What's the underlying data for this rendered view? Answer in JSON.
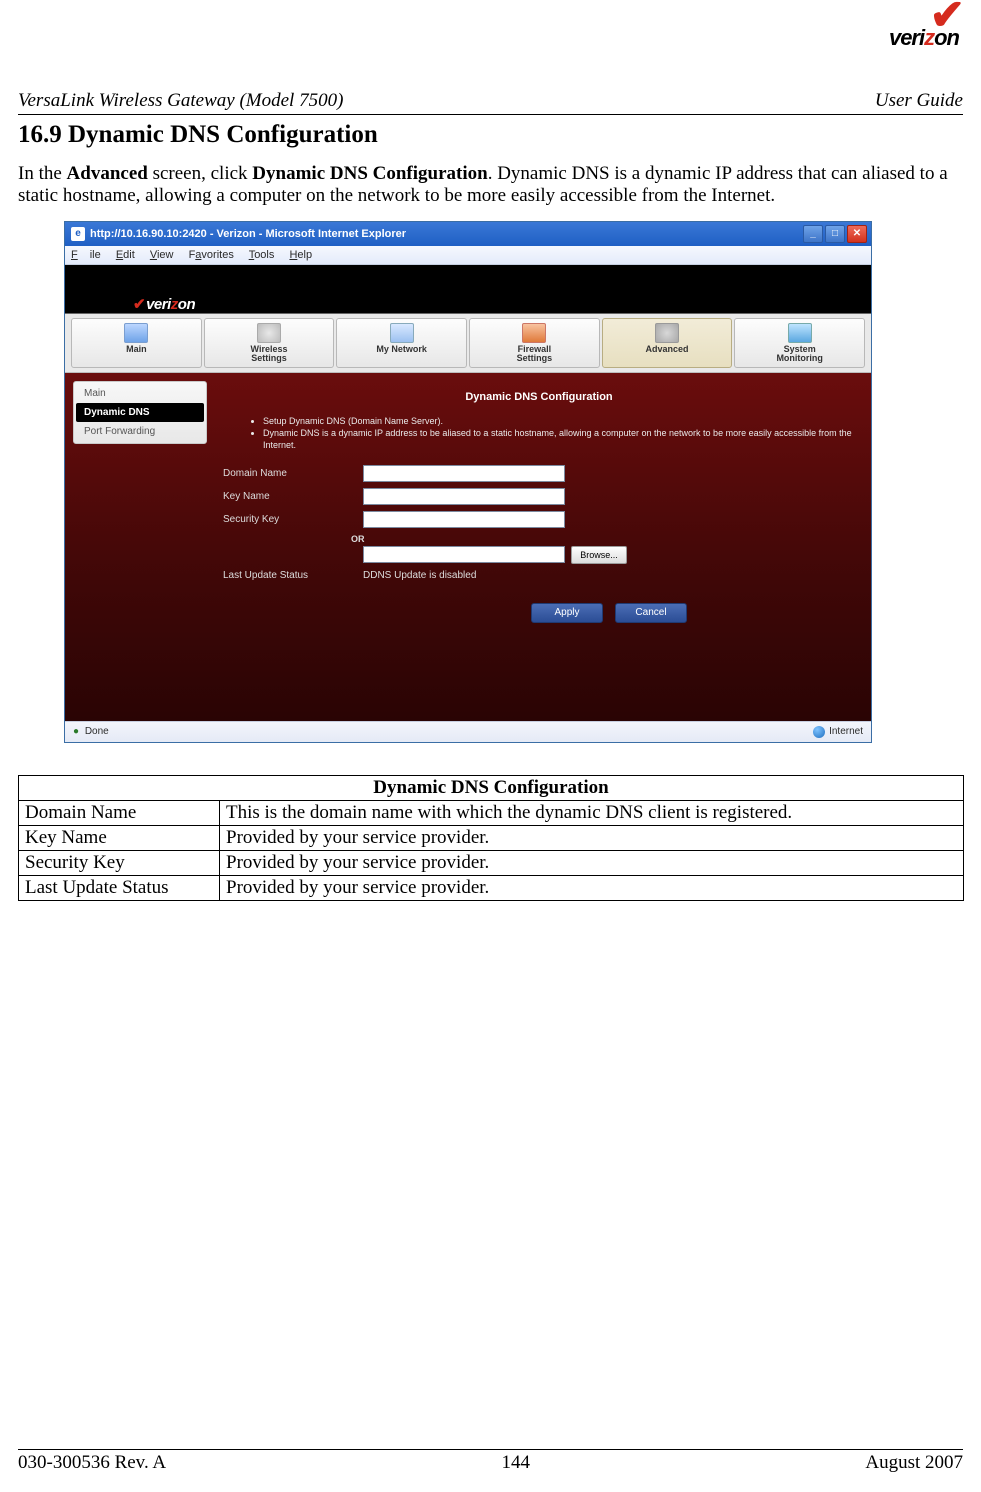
{
  "logo": {
    "brand_prefix": "veri",
    "brand_z": "z",
    "brand_suffix": "on"
  },
  "header": {
    "doc_title": "VersaLink Wireless Gateway (Model 7500)",
    "doc_kind": "User Guide"
  },
  "section": {
    "number_title": "16.9   Dynamic DNS Configuration"
  },
  "intro": {
    "pre": "In the ",
    "b1": "Advanced",
    "mid": " screen, click ",
    "b2": "Dynamic DNS Configuration",
    "post": ". Dynamic DNS is a dynamic IP address that can aliased to a static hostname, allowing a computer on the network to be more easily accessible from the Internet."
  },
  "ie": {
    "title": "http://10.16.90.10:2420 - Verizon - Microsoft Internet Explorer",
    "menu": {
      "file": "File",
      "edit": "Edit",
      "view": "View",
      "favorites": "Favorites",
      "tools": "Tools",
      "help": "Help"
    },
    "nav": {
      "main": "Main",
      "wireless": "Wireless\nSettings",
      "network": "My Network",
      "firewall": "Firewall\nSettings",
      "advanced": "Advanced",
      "sysmon": "System\nMonitoring"
    },
    "side": {
      "main": "Main",
      "ddns": "Dynamic DNS",
      "pfwd": "Port Forwarding"
    },
    "panel": {
      "title": "Dynamic DNS Configuration",
      "bullet1": "Setup Dynamic DNS (Domain Name Server).",
      "bullet2": "Dynamic DNS is a dynamic IP address to be aliased to a static hostname, allowing a computer on the network to be more easily accessible from the Internet.",
      "labels": {
        "domain": "Domain Name",
        "key": "Key Name",
        "sec": "Security Key",
        "or": "OR",
        "browse": "Browse...",
        "last": "Last Update Status",
        "status_val": "DDNS Update is disabled",
        "apply": "Apply",
        "cancel": "Cancel"
      }
    },
    "status_left": "Done",
    "status_right": "Internet"
  },
  "defs": {
    "title": "Dynamic DNS Configuration",
    "rows": [
      {
        "k": "Domain Name",
        "v": "This is the domain name with which the dynamic DNS client is registered."
      },
      {
        "k": "Key Name",
        "v": "Provided by your service provider."
      },
      {
        "k": "Security Key",
        "v": "Provided by your service provider."
      },
      {
        "k": "Last Update Status",
        "v": "Provided by your service provider."
      }
    ]
  },
  "footer": {
    "left": "030-300536 Rev. A",
    "center": "144",
    "right": "August 2007"
  }
}
